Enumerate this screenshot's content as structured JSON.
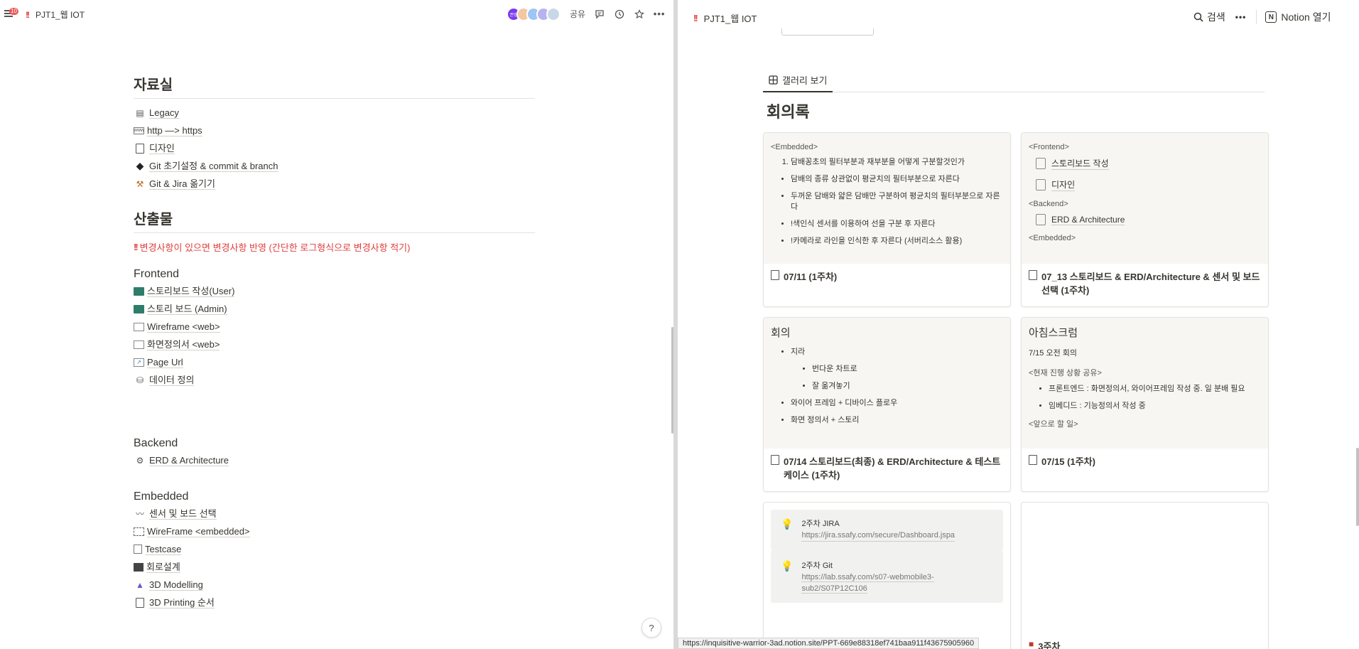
{
  "left": {
    "notification_count": "10",
    "page_icon": "!!",
    "title": "PJT1_웹 IOT",
    "avatars": [
      {
        "label": "권영",
        "color": "#7c3aed"
      },
      {
        "label": "",
        "color": "#f4c7a1"
      },
      {
        "label": "",
        "color": "#9ec5f4"
      },
      {
        "label": "",
        "color": "#b7b2f0"
      },
      {
        "label": "",
        "color": "#c9d8e8"
      }
    ],
    "share_label": "공유",
    "resources": {
      "heading": "자료실",
      "items": [
        {
          "icon": "archive-icon",
          "label": "Legacy"
        },
        {
          "icon": "http-icon",
          "label": "http —> https"
        },
        {
          "icon": "page-icon",
          "label": "디자인"
        },
        {
          "icon": "git-icon",
          "label": "Git 초기설정 & commit & branch"
        },
        {
          "icon": "tools-icon",
          "label": "Git & Jira 옮기기"
        }
      ]
    },
    "outputs": {
      "heading": "산출물",
      "warning_icon": "!!",
      "warning_text": "변경사항이 있으면 변경사항 반영 (간단한 로그형식으로 변경사항 적기)",
      "frontend": {
        "heading": "Frontend",
        "items": [
          {
            "icon": "storyboard-icon",
            "label": "스토리보드 작성(User)"
          },
          {
            "icon": "storyboard-icon",
            "label": "스토리 보드 (Admin)"
          },
          {
            "icon": "wireframe-icon",
            "label": "Wireframe <web>"
          },
          {
            "icon": "wireframe-icon",
            "label": "화면정의서 <web>"
          },
          {
            "icon": "url-icon",
            "label": "Page Url"
          },
          {
            "icon": "database-icon",
            "label": "데이터 정의"
          }
        ]
      },
      "backend": {
        "heading": "Backend",
        "items": [
          {
            "icon": "architecture-icon",
            "label": "ERD & Architecture"
          }
        ]
      },
      "embedded": {
        "heading": "Embedded",
        "items": [
          {
            "icon": "sensor-icon",
            "label": "센서 및 보드 선택"
          },
          {
            "icon": "wireframe-icon",
            "label": "WireFrame <embedded>"
          },
          {
            "icon": "testcase-icon",
            "label": "Testcase"
          },
          {
            "icon": "circuit-icon",
            "label": "회로설계"
          },
          {
            "icon": "modelling-icon",
            "label": "3D Modelling"
          },
          {
            "icon": "page-icon",
            "label": "3D Printing 순서"
          }
        ]
      }
    },
    "help_label": "?"
  },
  "right": {
    "page_icon": "!!",
    "title": "PJT1_웹 IOT",
    "search_label": "검색",
    "open_notion_label": "Notion 열기",
    "tab_label": "갤러리 보기",
    "heading": "회의록",
    "cards": [
      {
        "tag1": "<Embedded>",
        "ordered": [
          "담배꽁초의 필터부분과 재부분을 어떻게 구분할것인가"
        ],
        "bullets": [
          "담배의 종류 상관없이 평균치의 필터부분으로 자른다",
          "두꺼운 담배와 얇은 담배만 구분하여 평균치의 필터부분으로 자른다",
          "!색인식 센서를 이용하여 선을 구분 후 자른다",
          "!카메라로 라인을 인식한 후 자른다 (서버리소스 활용)"
        ],
        "title": "07/11 (1주차)"
      },
      {
        "tag1": "<Frontend>",
        "links1": [
          "스토리보드 작성",
          "디자인"
        ],
        "tag2": "<Backend>",
        "links2": [
          "ERD & Architecture"
        ],
        "tag3": "<Embedded>",
        "title": "07_13 스토리보드 & ERD/Architecture & 센서 및 보드 선택 (1주차)"
      },
      {
        "cover_title": "회의",
        "b1": "지라",
        "sub": [
          "번다운 차트로",
          "잘 옮겨놓기"
        ],
        "b2": "와이어 프레임 + 디바이스 플로우",
        "b3": "화면 정의서 + 스토리",
        "title": "07/14 스토리보드(최종) & ERD/Architecture & 테스트케이스 (1주차)"
      },
      {
        "cover_title": "아침스크럼",
        "line1": "7/15 오전 회의",
        "tag1": "<현재 진행 상황 공유>",
        "bullets": [
          "프론트엔드 : 화면정의서, 와이어프레임 작성 중. 일 분배 필요",
          "임베디드 : 기능정의서 작성 중"
        ],
        "tag2": "<앞으로 할 일>",
        "title": "07/15 (1주차)"
      },
      {
        "callouts": [
          {
            "title": "2주차 JIRA",
            "link": "https://jira.ssafy.com/secure/Dashboard.jspa"
          },
          {
            "title": "2주차 Git",
            "link": "https://lab.ssafy.com/s07-webmobile3-sub2/S07P12C106"
          }
        ]
      },
      {
        "title": "3주차"
      }
    ],
    "status_url": "https://inquisitive-warrior-3ad.notion.site/PPT-669e88318ef741baa911f43675905960"
  }
}
